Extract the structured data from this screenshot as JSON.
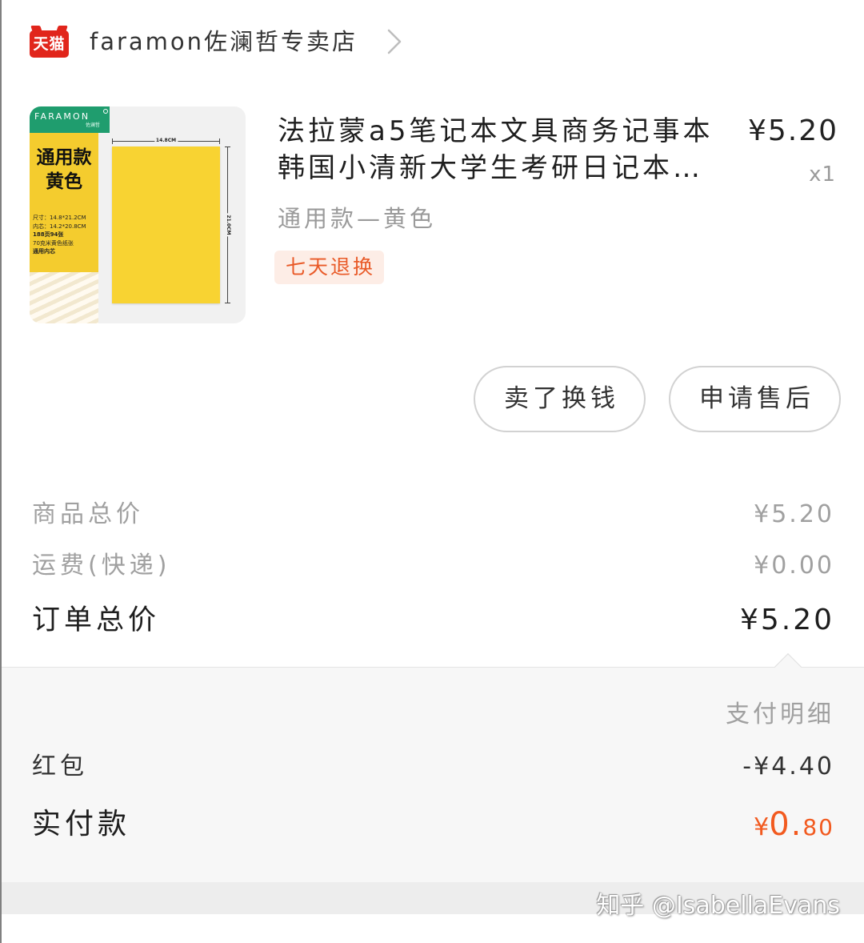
{
  "store": {
    "platform_logo_text": "天猫",
    "name": "faramon佐澜哲专卖店"
  },
  "product": {
    "image": {
      "brand": "FARAMON",
      "brand_sub": "佐澜哲",
      "label_line1": "通用款",
      "label_line2": "黄色",
      "specs": [
        "尺寸：14.8*21.2CM",
        "内芯：14.2*20.8CM",
        "188页94张",
        "70克米黄色纸张",
        "通用内芯"
      ],
      "width_label": "14.8CM",
      "height_label": "21.0CM"
    },
    "title_lines": [
      "法拉蒙a5笔记本文具商务记事本",
      "韩国小清新大学生考研日记本…"
    ],
    "price": "¥5.20",
    "quantity": "x1",
    "variant": "通用款—黄色",
    "tag": "七天退换"
  },
  "actions": {
    "resell_label": "卖了换钱",
    "after_sale_label": "申请售后"
  },
  "summary": {
    "rows": [
      {
        "label": "商品总价",
        "value": "¥5.20"
      },
      {
        "label": "运费(快递)",
        "value": "¥0.00"
      }
    ],
    "total_label": "订单总价",
    "total_value": "¥5.20"
  },
  "payment": {
    "detail_title": "支付明细",
    "rows": [
      {
        "label": "红包",
        "value": "-¥4.40"
      }
    ],
    "paid_label": "实付款",
    "paid_amount": {
      "symbol": "¥",
      "integer": "0.",
      "fraction": "80"
    }
  },
  "watermark": "知乎 @IsabellaEvans",
  "icons": {
    "platform_logo": "tmall-logo-icon",
    "store_link": "chevron-right-icon",
    "brand_mark": "registered-mark-icon"
  },
  "colors": {
    "tmall_red": "#e1251b",
    "accent_orange": "#f25a1f",
    "tag_background": "#fdede6",
    "tag_text": "#e95a28",
    "brand_green": "#1f9d6e",
    "label_yellow": "#f4cc2e",
    "notebook_yellow": "#f8d332",
    "payment_background": "#f7f7f7"
  }
}
